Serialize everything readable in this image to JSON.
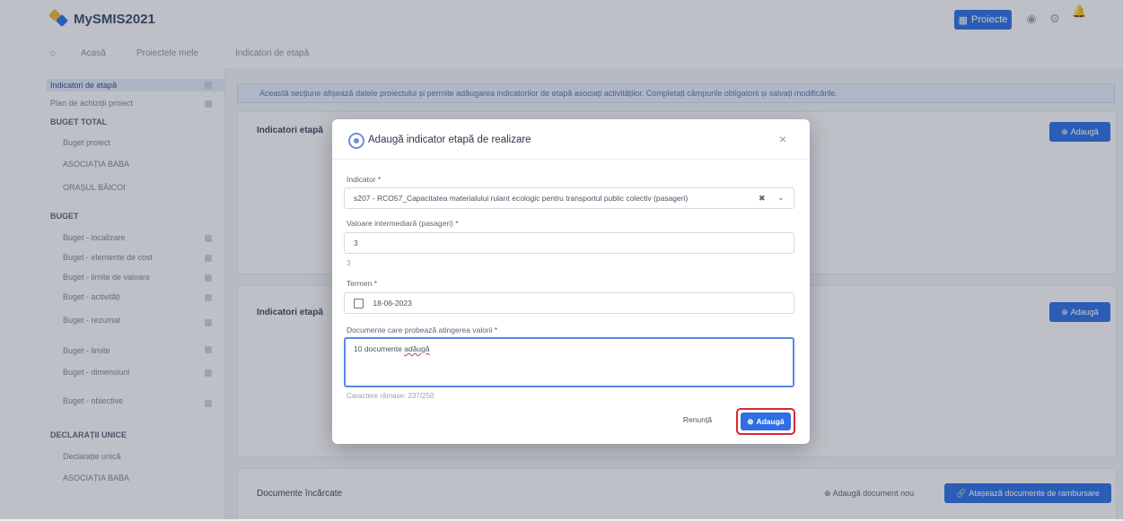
{
  "app": {
    "title": "MySMIS2021"
  },
  "header": {
    "project_btn": "Proiecte"
  },
  "navrow": {
    "tabs": [
      "Acasă",
      "Proiectele mele",
      "Indicatori de etapă"
    ]
  },
  "sidebar": {
    "items": [
      {
        "label": "Indicatori de etapă"
      },
      {
        "label": "Plan de achiziții proiect"
      },
      {
        "label": "BUGET TOTAL"
      },
      {
        "label": "Buget proiect"
      },
      {
        "label": "ASOCIAȚIA BABA"
      },
      {
        "label": "ORAȘUL BĂICOI"
      },
      {
        "label": "BUGET"
      },
      {
        "label": "Buget - localizare"
      },
      {
        "label": "Buget - elemente de cost"
      },
      {
        "label": "Buget - limite de valoare"
      },
      {
        "label": "Buget - activități"
      },
      {
        "label": "Buget - rezumat"
      },
      {
        "label": "Buget - limite"
      },
      {
        "label": "Buget - dimensiuni"
      },
      {
        "label": "Buget - obiective"
      },
      {
        "label": "DECLARAȚII UNICE"
      },
      {
        "label": "Declarație unică"
      },
      {
        "label": "ASOCIAȚIA BABA"
      }
    ]
  },
  "main": {
    "info_text": "Această secțiune afișează datele proiectului și permite adăugarea indicatorilor de etapă asociați activităților. Completați câmpurile obligatorii și salvați modificările.",
    "card1_title": "Indicatori etapă",
    "card2_title": "Indicatori etapă",
    "card3_title": "Documente încărcate",
    "add_label": "Adaugă",
    "add_doc_label": "Adaugă document nou",
    "attach_label": "Atașează documente de rambursare"
  },
  "modal": {
    "title": "Adaugă indicator etapă de realizare",
    "indicator_label": "Indicator *",
    "indicator_value": "s207 - RCO57_Capacitatea materialului rulant ecologic pentru transportul public colectiv (pasageri)",
    "value_label": "Valoare intermediară (pasageri) *",
    "value_value": "3",
    "value_helper": "3",
    "term_label": "Termen *",
    "term_value": "18-06-2023",
    "docs_label": "Documente care probează atingerea valorii *",
    "docs_value_prefix": "10 documente ",
    "docs_value_word": "adăugă",
    "docs_helper": "Caractere rămase: 237/250",
    "cancel_label": "Renunță",
    "add_label": "Adaugă"
  }
}
